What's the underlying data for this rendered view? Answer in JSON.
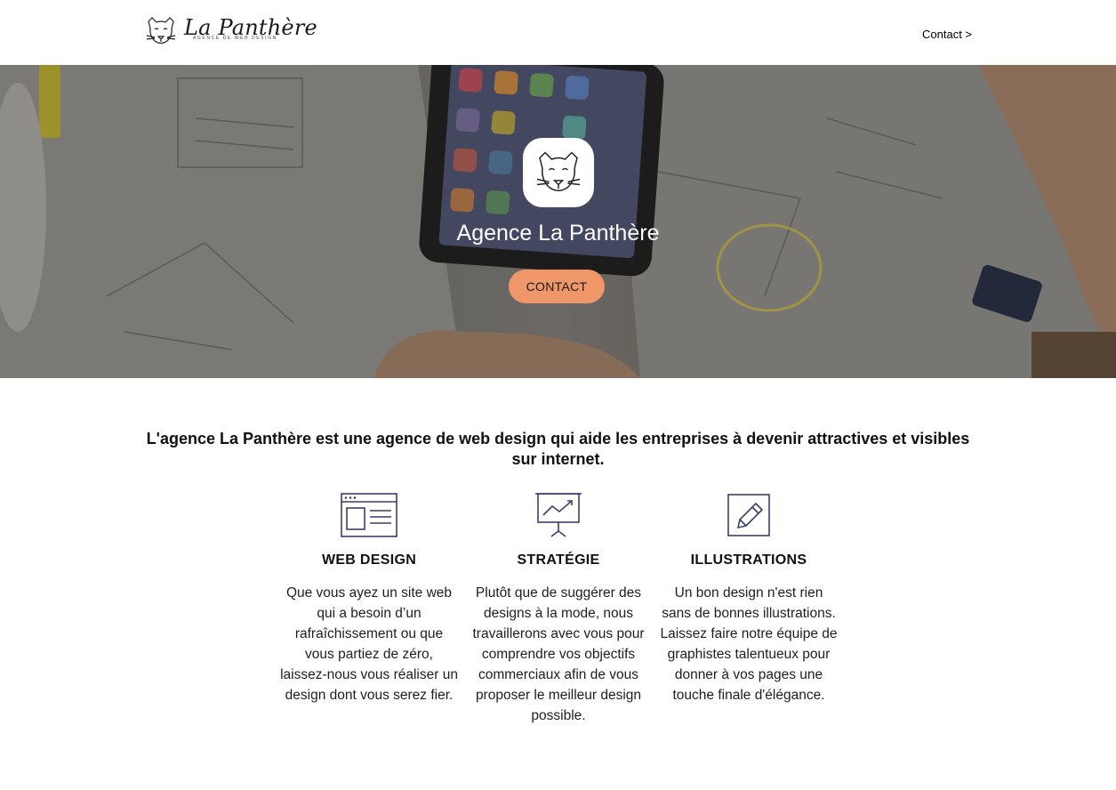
{
  "header": {
    "logo_name": "La Panthère",
    "logo_tagline": "AGENCE DE WEB DESIGN",
    "logo_icon": "panther-head-icon",
    "nav_contact": "Contact >"
  },
  "hero": {
    "badge_icon": "panther-head-icon",
    "title": "Agence La Panthère",
    "cta_label": "CONTACT",
    "cta_color": "#f0976a"
  },
  "intro": {
    "text": "L'agence La Panthère est une agence de web design qui aide les entreprises à devenir attractives et visibles sur internet."
  },
  "features": [
    {
      "icon": "browser-window-icon",
      "title": "WEB DESIGN",
      "text": "Que vous ayez un site web qui a besoin d’un rafraîchissement ou que vous partiez de zéro, laissez-nous vous réaliser un design dont vous serez fier."
    },
    {
      "icon": "presentation-chart-icon",
      "title": "STRATÉGIE",
      "text": "Plutôt que de suggérer des designs à la mode, nous travaillerons avec vous pour comprendre vos objectifs commerciaux afin de vous proposer le meilleur design possible."
    },
    {
      "icon": "pencil-square-icon",
      "title": "ILLUSTRATIONS",
      "text": "Un bon design n'est rien sans de bonnes illustrations. Laissez faire notre équipe de graphistes talentueux pour donner à vos pages une touche finale d'élégance."
    }
  ],
  "colors": {
    "accent": "#f0976a",
    "icon_stroke": "#3b3f6b"
  }
}
